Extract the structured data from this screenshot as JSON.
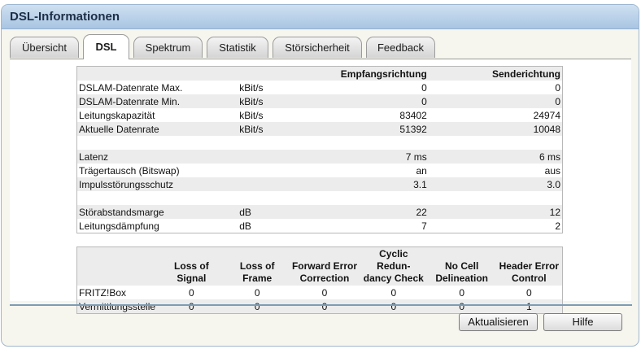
{
  "title": "DSL-Informationen",
  "tabs": [
    {
      "label": "Übersicht"
    },
    {
      "label": "DSL"
    },
    {
      "label": "Spektrum"
    },
    {
      "label": "Statistik"
    },
    {
      "label": "Störsicherheit"
    },
    {
      "label": "Feedback"
    }
  ],
  "active_tab": "DSL",
  "info_table": {
    "headers": {
      "rx": "Empfangsrichtung",
      "tx": "Senderichtung"
    },
    "rows": [
      {
        "label": "DSLAM-Datenrate Max.",
        "unit": "kBit/s",
        "rx": "0",
        "tx": "0"
      },
      {
        "label": "DSLAM-Datenrate Min.",
        "unit": "kBit/s",
        "rx": "0",
        "tx": "0"
      },
      {
        "label": "Leitungskapazität",
        "unit": "kBit/s",
        "rx": "83402",
        "tx": "24974"
      },
      {
        "label": "Aktuelle Datenrate",
        "unit": "kBit/s",
        "rx": "51392",
        "tx": "10048"
      },
      {
        "label": "",
        "unit": "",
        "rx": "",
        "tx": ""
      },
      {
        "label": "Latenz",
        "unit": "",
        "rx": "7 ms",
        "tx": "6 ms"
      },
      {
        "label": "Trägertausch (Bitswap)",
        "unit": "",
        "rx": "an",
        "tx": "aus"
      },
      {
        "label": "Impulsstörungsschutz",
        "unit": "",
        "rx": "3.1",
        "tx": "3.0"
      },
      {
        "label": "",
        "unit": "",
        "rx": "",
        "tx": ""
      },
      {
        "label": "Störabstandsmarge",
        "unit": "dB",
        "rx": "22",
        "tx": "12"
      },
      {
        "label": "Leitungsdämpfung",
        "unit": "dB",
        "rx": "7",
        "tx": "2"
      }
    ]
  },
  "error_table": {
    "headers": [
      {
        "line1": "Loss of",
        "line2": "Signal"
      },
      {
        "line1": "Loss of",
        "line2": "Frame"
      },
      {
        "line1": "Forward Error",
        "line2": "Correction"
      },
      {
        "line1": "Cyclic Redun-",
        "line2": "dancy Check"
      },
      {
        "line1": "No Cell",
        "line2": "Delineation"
      },
      {
        "line1": "Header Error",
        "line2": "Control"
      }
    ],
    "rows": [
      {
        "label": "FRITZ!Box",
        "values": [
          "0",
          "0",
          "0",
          "0",
          "0",
          "0"
        ]
      },
      {
        "label": "Vermittlungsstelle",
        "values": [
          "0",
          "0",
          "0",
          "0",
          "0",
          "1"
        ]
      }
    ]
  },
  "buttons": {
    "refresh": "Aktualisieren",
    "help": "Hilfe"
  }
}
